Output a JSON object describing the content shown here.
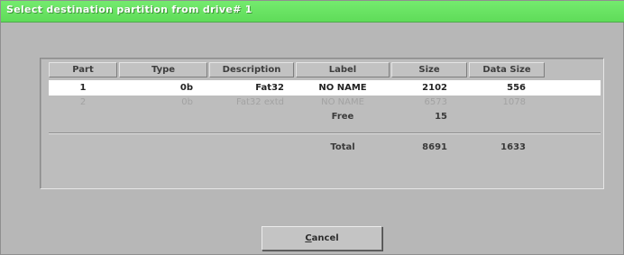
{
  "window": {
    "title": "Select destination partition from drive# 1"
  },
  "table": {
    "columns": [
      "Part",
      "Type",
      "Description",
      "Label",
      "Size",
      "Data Size"
    ],
    "rows": [
      {
        "part": "1",
        "type": "0b",
        "description": "Fat32",
        "label": "NO NAME",
        "size": "2102",
        "data_size": "556",
        "state": "selected"
      },
      {
        "part": "2",
        "type": "0b",
        "description": "Fat32 extd",
        "label": "NO NAME",
        "size": "6573",
        "data_size": "1078",
        "state": "disabled"
      }
    ],
    "free": {
      "label": "Free",
      "size": "15"
    },
    "total": {
      "label": "Total",
      "size": "8691",
      "data_size": "1633"
    }
  },
  "buttons": {
    "cancel_accel": "C",
    "cancel_rest": "ancel"
  }
}
